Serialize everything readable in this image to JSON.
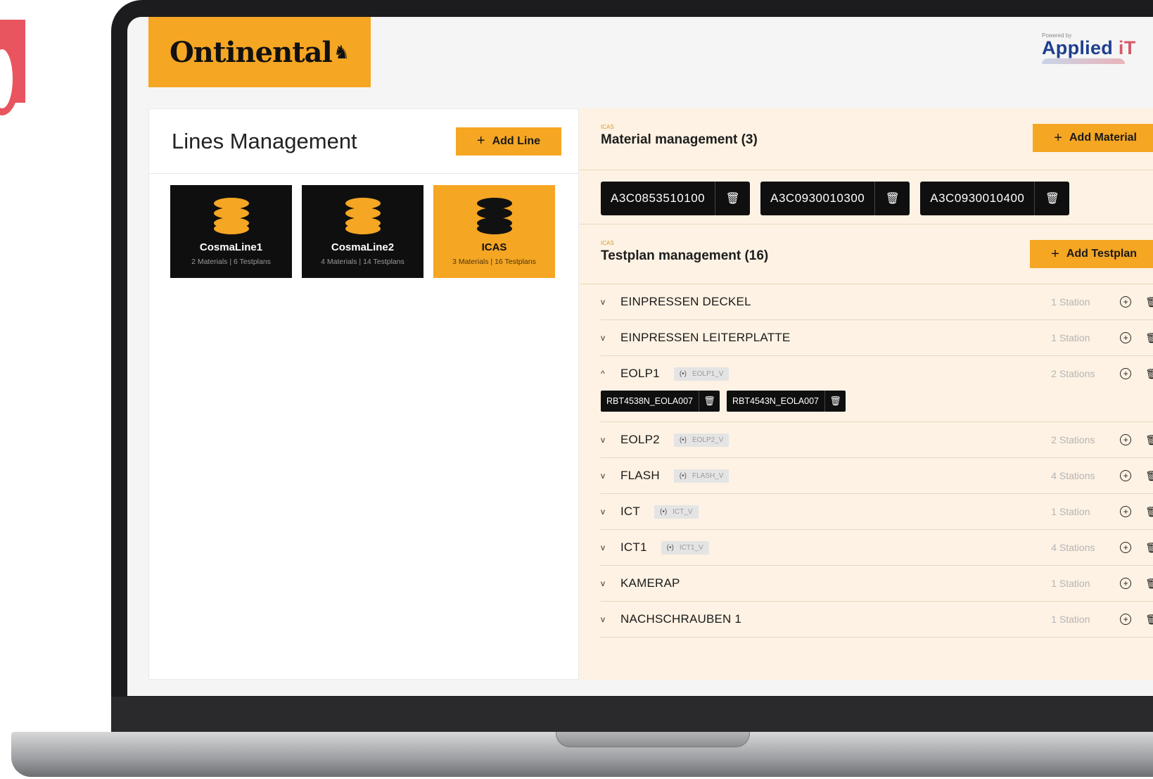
{
  "header": {
    "brand": "Ontinental",
    "powered_by": "Powered by",
    "partner_name_main": "Applied",
    "partner_name_accent": "iT"
  },
  "lines_panel": {
    "title": "Lines Management",
    "add_label": "Add Line",
    "lines": [
      {
        "name": "CosmaLine1",
        "subtitle": "2 Materials | 6 Testplans",
        "active": false
      },
      {
        "name": "CosmaLine2",
        "subtitle": "4 Materials | 14 Testplans",
        "active": false
      },
      {
        "name": "ICAS",
        "subtitle": "3 Materials | 16 Testplans",
        "active": true
      }
    ]
  },
  "materials": {
    "tag": "ICAS",
    "title": "Material management (3)",
    "add_label": "Add Material",
    "items": [
      "A3C0853510100",
      "A3C0930010300",
      "A3C0930010400"
    ]
  },
  "testplans": {
    "tag": "ICAS",
    "title": "Testplan management (16)",
    "add_label": "Add Testplan",
    "rows": [
      {
        "name": "EINPRESSEN DECKEL",
        "variant": "",
        "stations": "1 Station"
      },
      {
        "name": "EINPRESSEN LEITERPLATTE",
        "variant": "",
        "stations": "1 Station"
      },
      {
        "name": "EOLP1",
        "variant": "EOLP1_V",
        "stations": "2 Stations",
        "expanded": true,
        "station_items": [
          "RBT4538N_EOLA007",
          "RBT4543N_EOLA007"
        ]
      },
      {
        "name": "EOLP2",
        "variant": "EOLP2_V",
        "stations": "2 Stations"
      },
      {
        "name": "FLASH",
        "variant": "FLASH_V",
        "stations": "4 Stations"
      },
      {
        "name": "ICT",
        "variant": "ICT_V",
        "stations": "1 Station"
      },
      {
        "name": "ICT1",
        "variant": "ICT1_V",
        "stations": "4 Stations"
      },
      {
        "name": "KAMERAP",
        "variant": "",
        "stations": "1 Station"
      },
      {
        "name": "NACHSCHRAUBEN 1",
        "variant": "",
        "stations": "1 Station"
      }
    ]
  },
  "colors": {
    "accent": "#f5a623",
    "dark": "#0f0f0f",
    "panel_tint": "#fdf2e3"
  },
  "icons": {
    "plus": "+",
    "chevron_down": "⌄",
    "chevron_up": "⌃",
    "trash": "🗑",
    "add_circle": "+",
    "variant": "(•)"
  }
}
